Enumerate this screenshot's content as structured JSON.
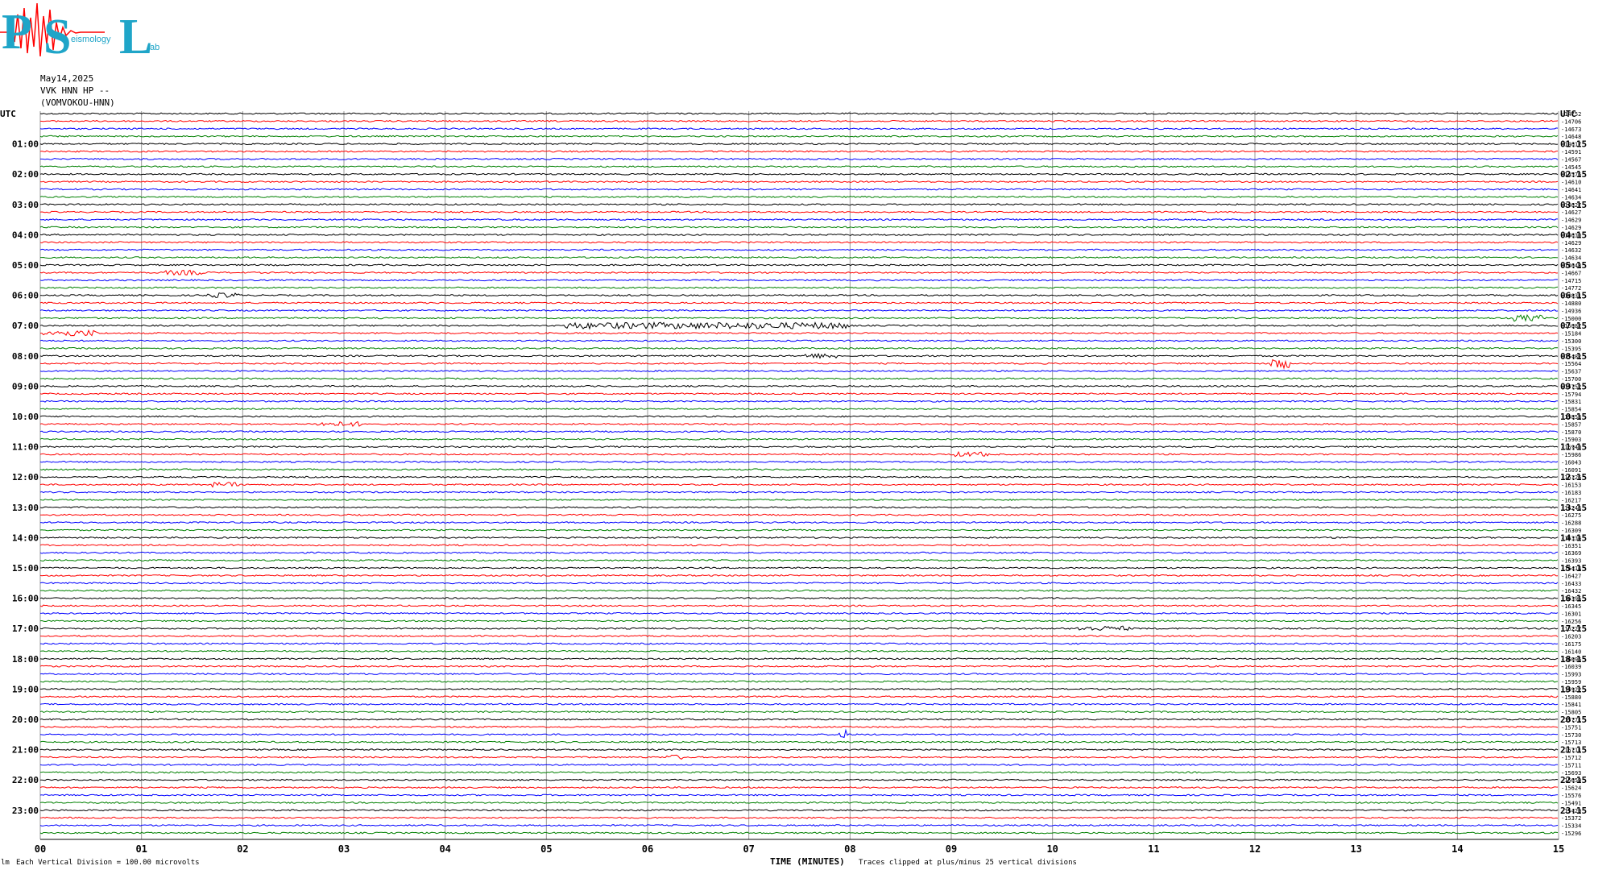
{
  "logo": {
    "letters": "PSL",
    "subtitle_s": "eismology",
    "subtitle_l": "ab"
  },
  "header": {
    "date": "May14,2025",
    "channel": "VVK HNN HP --",
    "station": "(VOMVOKOU-HNN)"
  },
  "colors": {
    "trace_cycle": [
      "#000000",
      "#ff0000",
      "#0000ff",
      "#008000"
    ],
    "grid": "#999999",
    "logo": "#1fa5c8",
    "logo_wave": "#ff0000"
  },
  "chart_data": {
    "type": "line",
    "title": "",
    "xlabel": "TIME (MINUTES)",
    "xlim": [
      0,
      15
    ],
    "x_ticks": [
      "00",
      "01",
      "02",
      "03",
      "04",
      "05",
      "06",
      "07",
      "08",
      "09",
      "10",
      "11",
      "12",
      "13",
      "14",
      "15"
    ],
    "utc_label": "UTC",
    "left_labels": [
      "01:00",
      "02:00",
      "03:00",
      "04:00",
      "05:00",
      "06:00",
      "07:00",
      "08:00",
      "09:00",
      "10:00",
      "11:00",
      "12:00",
      "13:00",
      "14:00",
      "15:00",
      "16:00",
      "17:00",
      "18:00",
      "19:00",
      "20:00",
      "21:00",
      "22:00",
      "23:00"
    ],
    "right_labels": [
      "01:15",
      "02:15",
      "03:15",
      "04:15",
      "05:15",
      "06:15",
      "07:15",
      "08:15",
      "09:15",
      "10:15",
      "11:15",
      "12:15",
      "13:15",
      "14:15",
      "15:15",
      "16:15",
      "17:15",
      "18:15",
      "19:15",
      "20:15",
      "21:15",
      "22:15",
      "23:15"
    ],
    "trace_values": [
      "-14752",
      "-14706",
      "-14673",
      "-14648",
      "-14617",
      "-14591",
      "-14567",
      "-14545",
      "-14576",
      "-14610",
      "-14641",
      "-14634",
      "-14627",
      "-14627",
      "-14629",
      "-14629",
      "-14630",
      "-14629",
      "-14632",
      "-14634",
      "-14648",
      "-14667",
      "-14715",
      "-14772",
      "-14831",
      "-14880",
      "-14936",
      "-15000",
      "-15087",
      "-15184",
      "-15300",
      "-15395",
      "-15482",
      "-15564",
      "-15637",
      "-15700",
      "-15752",
      "-15794",
      "-15831",
      "-15854",
      "-15853",
      "-15857",
      "-15870",
      "-15903",
      "-15940",
      "-15986",
      "-16043",
      "-16091",
      "-16126",
      "-16153",
      "-16183",
      "-16217",
      "-16246",
      "-16275",
      "-16288",
      "-16309",
      "-16334",
      "-16351",
      "-16369",
      "-16393",
      "-16414",
      "-16427",
      "-16433",
      "-16432",
      "-16395",
      "-16345",
      "-16301",
      "-16256",
      "-16227",
      "-16203",
      "-16175",
      "-16140",
      "-16096",
      "-16039",
      "-15993",
      "-15959",
      "-15922",
      "-15880",
      "-15841",
      "-15805",
      "-15771",
      "-15751",
      "-15730",
      "-15713",
      "-15711",
      "-15712",
      "-15711",
      "-15693",
      "-15659",
      "-15624",
      "-15576",
      "-15491",
      "-15429",
      "-15372",
      "-15334",
      "-15296"
    ],
    "bursts": [
      {
        "trace": 21,
        "x": 1.45,
        "width": 0.4,
        "amp": 3
      },
      {
        "trace": 24,
        "x": 1.8,
        "width": 0.3,
        "amp": 3
      },
      {
        "trace": 29,
        "x": 0.3,
        "width": 0.5,
        "amp": 4
      },
      {
        "trace": 28,
        "x": 6.6,
        "width": 2.8,
        "amp": 4
      },
      {
        "trace": 27,
        "x": 14.7,
        "width": 0.25,
        "amp": 4
      },
      {
        "trace": 32,
        "x": 7.7,
        "width": 0.3,
        "amp": 3
      },
      {
        "trace": 33,
        "x": 12.25,
        "width": 0.15,
        "amp": 6
      },
      {
        "trace": 41,
        "x": 2.95,
        "width": 0.4,
        "amp": 3
      },
      {
        "trace": 45,
        "x": 9.2,
        "width": 0.3,
        "amp": 3
      },
      {
        "trace": 49,
        "x": 1.8,
        "width": 0.3,
        "amp": 3
      },
      {
        "trace": 68,
        "x": 10.5,
        "width": 0.5,
        "amp": 3
      },
      {
        "trace": 82,
        "x": 7.93,
        "width": 0.04,
        "amp": 9
      },
      {
        "trace": 85,
        "x": 6.25,
        "width": 0.15,
        "amp": 3
      }
    ]
  },
  "footer": {
    "left": "Each Vertical Division =  100.00 microvolts",
    "corner": "lm",
    "center": "TIME (MINUTES)",
    "note": "Traces clipped at plus/minus 25 vertical divisions"
  }
}
